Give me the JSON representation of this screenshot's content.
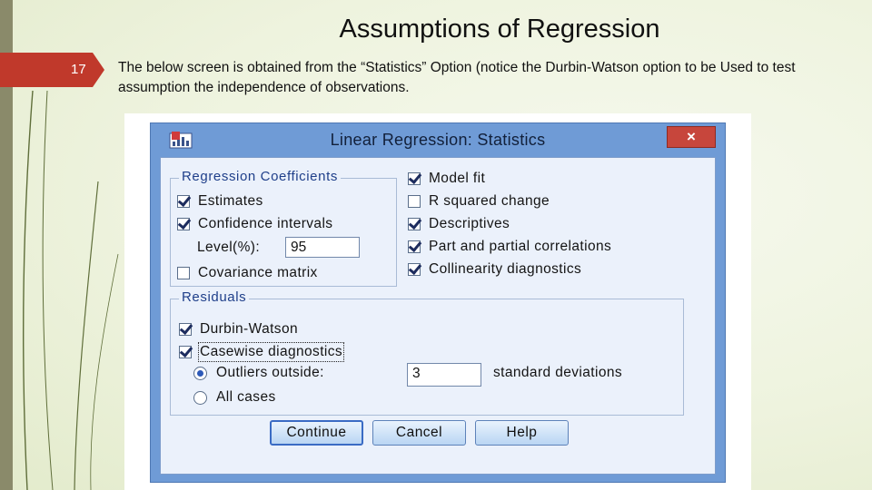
{
  "slide": {
    "number": "17",
    "title": "Assumptions of Regression",
    "body": "The below screen is obtained from the “Statistics” Option (notice the Durbin-Watson option to be Used to test assumption the independence of observations."
  },
  "dialog": {
    "title": "Linear Regression: Statistics",
    "close_glyph": "×",
    "regression_coefficients": {
      "title": "Regression Coefficients",
      "estimates": {
        "label": "Estimates",
        "checked": true
      },
      "confidence_intervals": {
        "label": "Confidence intervals",
        "checked": true
      },
      "level_label": "Level(%):",
      "level_value": "95",
      "covariance_matrix": {
        "label": "Covariance matrix",
        "checked": false
      }
    },
    "right_options": {
      "model_fit": {
        "label": "Model fit",
        "checked": true
      },
      "r_squared_change": {
        "label": "R squared change",
        "checked": false
      },
      "descriptives": {
        "label": "Descriptives",
        "checked": true
      },
      "part_partial": {
        "label": "Part and partial correlations",
        "checked": true
      },
      "collinearity": {
        "label": "Collinearity diagnostics",
        "checked": true
      }
    },
    "residuals": {
      "title": "Residuals",
      "durbin_watson": {
        "label": "Durbin-Watson",
        "checked": true
      },
      "casewise": {
        "label": "Casewise diagnostics",
        "checked": true
      },
      "outliers_outside": {
        "label": "Outliers outside:",
        "selected": true
      },
      "outliers_value": "3",
      "std_dev_label": "standard deviations",
      "all_cases": {
        "label": "All cases",
        "selected": false
      }
    },
    "buttons": {
      "continue": "Continue",
      "cancel": "Cancel",
      "help": "Help"
    }
  },
  "icons": {
    "app": "spss-regression-icon",
    "close": "close-icon"
  },
  "colors": {
    "slide_number_tab": "#c0392b",
    "dialog_frame": "#6f9bd6",
    "close_button": "#c7463c"
  }
}
